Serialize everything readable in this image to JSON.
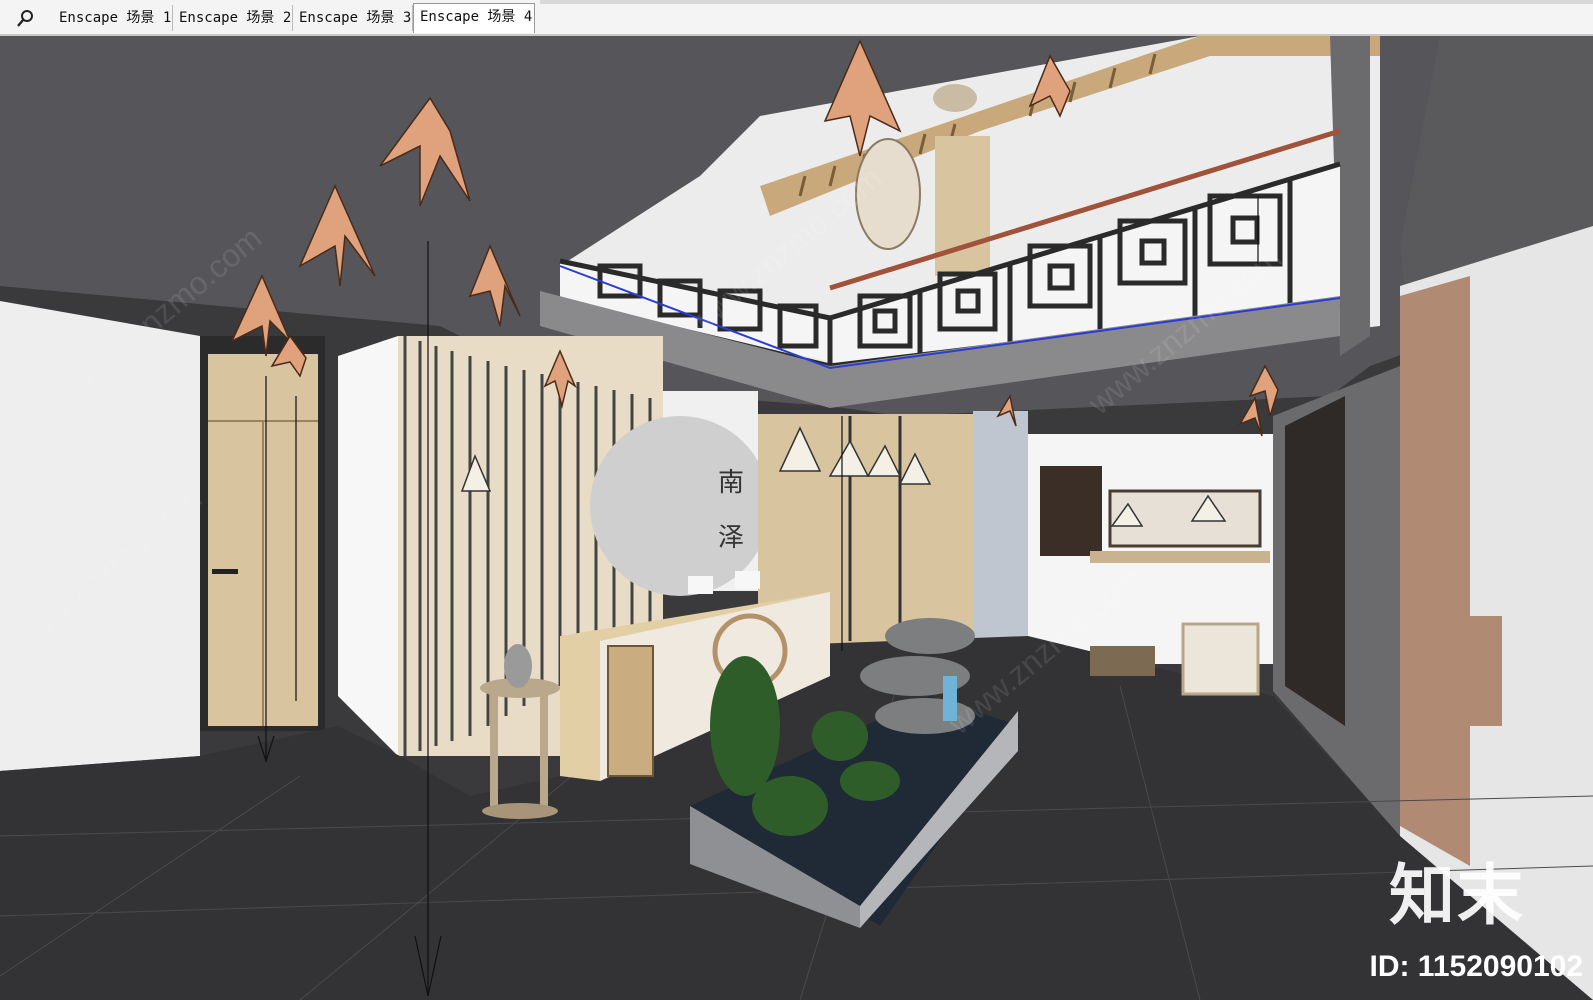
{
  "toolbar": {
    "search_icon": "magnifier-icon",
    "tabs": [
      {
        "label": "Enscape 场景 1"
      },
      {
        "label": "Enscape 场景 2"
      },
      {
        "label": "Enscape 场景 3"
      },
      {
        "label": "Enscape 场景 4"
      }
    ],
    "active_tab": "Enscape 场景 4"
  },
  "viewport": {
    "scene": "interior-3d-model-lobby",
    "watermark_text": "www.znzmo.com",
    "watermark_brand": "知末网"
  },
  "watermark": {
    "brand": "知末",
    "id": "ID: 1152090102"
  },
  "colors": {
    "ceiling": "#56565a",
    "floor": "#333336",
    "wood": "#d9c4a0",
    "lamp": "#e0a27c",
    "wall_white": "#f2f2f2",
    "lattice": "#2a2a2a"
  }
}
